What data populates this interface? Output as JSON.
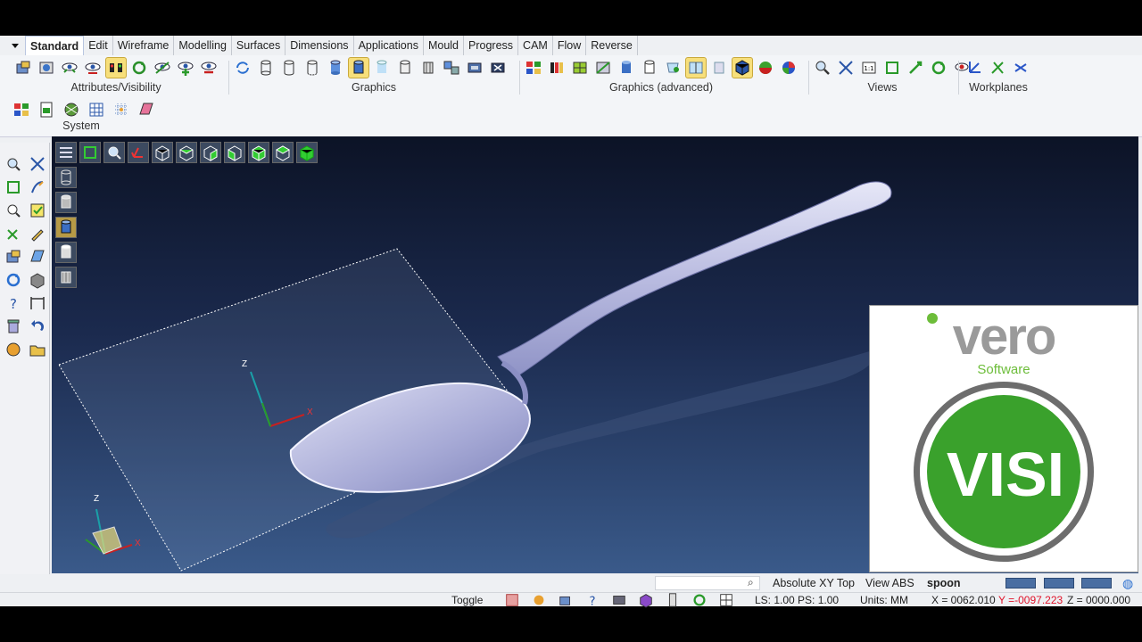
{
  "ribbon": {
    "tabs": [
      "Standard",
      "Edit",
      "Wireframe",
      "Modelling",
      "Surfaces",
      "Dimensions",
      "Applications",
      "Mould",
      "Progress",
      "CAM",
      "Flow",
      "Reverse"
    ],
    "groups": {
      "attributes": "Attributes/Visibility",
      "graphics": "Graphics",
      "graphics_advanced": "Graphics (advanced)",
      "views": "Views",
      "workplanes": "Workplanes",
      "system": "System"
    }
  },
  "viewport": {
    "axis_labels": {
      "z": "Z",
      "x": "X"
    }
  },
  "logo": {
    "brand": "vero",
    "sub": "Software",
    "product": "VISI"
  },
  "status": {
    "plane": "Absolute XY Top",
    "view": "View ABS",
    "filename": "spoon",
    "toggle": "Toggle",
    "ls_ps": "LS: 1.00 PS: 1.00",
    "units": "Units: MM",
    "x_coord": "X = 0062.010",
    "y_coord": "Y =-0097.223",
    "z_coord": "Z = 0000.000"
  },
  "colors": {
    "accent": "#f7df7b",
    "logo_green": "#3aa12c",
    "coord_y": "#e0142b"
  }
}
